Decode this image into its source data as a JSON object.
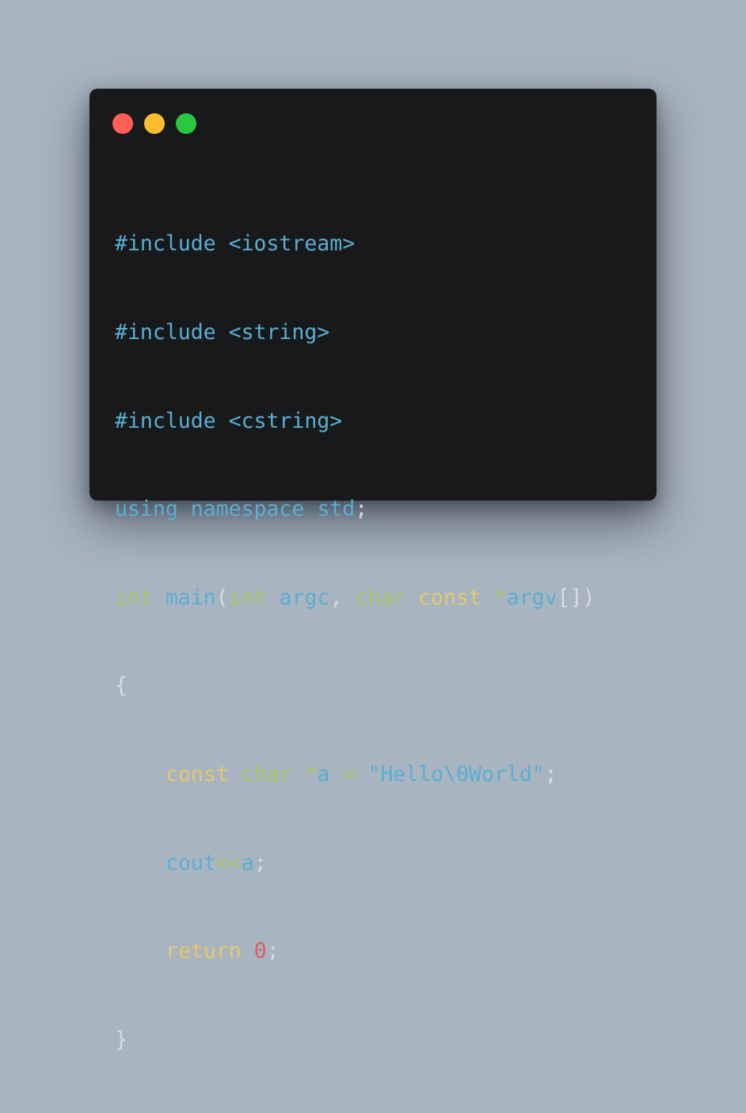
{
  "window": {
    "controls": {
      "close_color": "#ff5f57",
      "minimize_color": "#febc2e",
      "maximize_color": "#28c840"
    }
  },
  "colors": {
    "background": "#a9b4c1",
    "editor_background": "#18191b",
    "preprocessor": "#5aaed1",
    "keyword_green": "#a6c96a",
    "keyword_yellow": "#e3c86e",
    "identifier": "#5aaed1",
    "punctuation": "#d7dce2",
    "number": "#df5e5e"
  },
  "code": {
    "lines": [
      {
        "tokens": [
          "#include",
          " ",
          "<iostream>"
        ]
      },
      {
        "tokens": [
          "#include",
          " ",
          "<string>"
        ]
      },
      {
        "tokens": [
          "#include",
          " ",
          "<cstring>"
        ]
      },
      {
        "tokens": [
          "using",
          " ",
          "namespace",
          " ",
          "std",
          ";"
        ]
      },
      {
        "tokens": [
          "int",
          " ",
          "main",
          "(",
          "int",
          " ",
          "argc",
          ",",
          " ",
          "char",
          " ",
          "const",
          " ",
          "*",
          "argv",
          "[])"
        ]
      },
      {
        "tokens": [
          "{"
        ]
      },
      {
        "tokens": [
          "const",
          " ",
          "char",
          " ",
          "*",
          "a",
          " ",
          "=",
          " ",
          "\"Hello\\0World\"",
          ";"
        ]
      },
      {
        "tokens": [
          "cout",
          "<<",
          "a",
          ";"
        ]
      },
      {
        "tokens": [
          "return",
          " ",
          "0",
          ";"
        ]
      },
      {
        "tokens": [
          "}"
        ]
      }
    ]
  }
}
